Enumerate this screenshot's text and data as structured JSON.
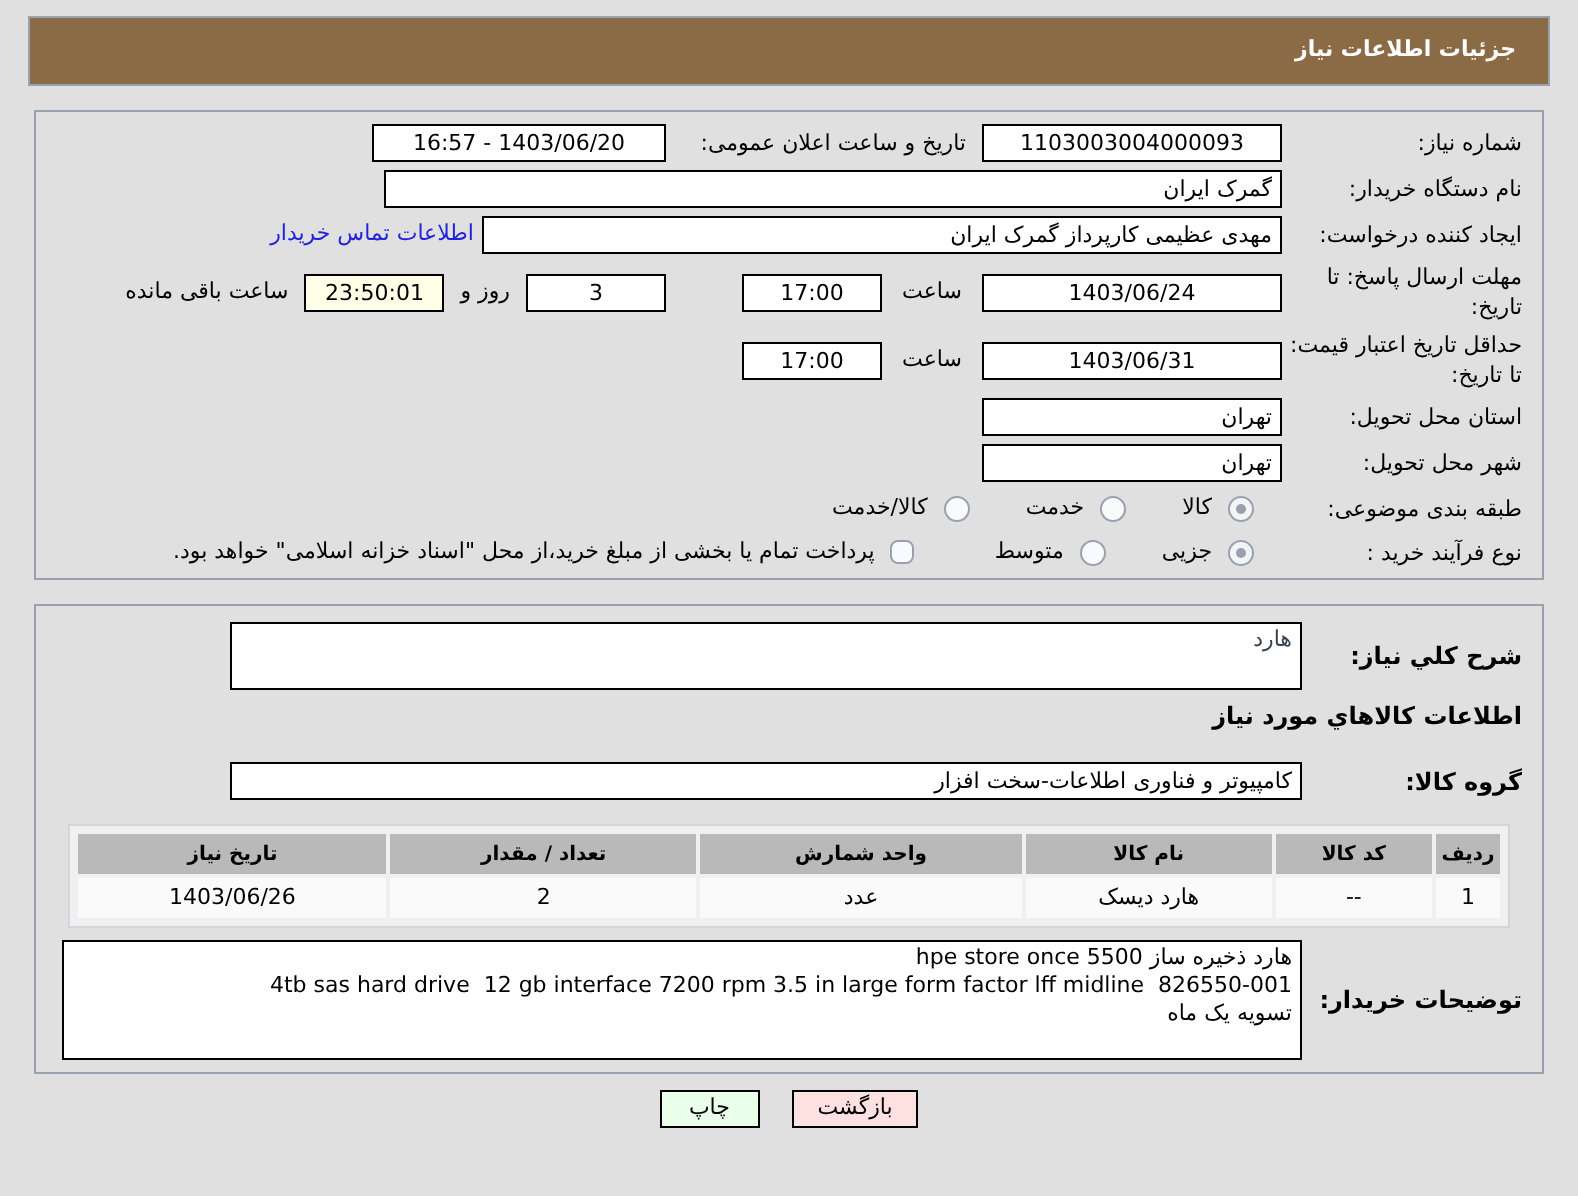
{
  "header": {
    "title": "جزئیات اطلاعات نیاز"
  },
  "need_number": {
    "label": "شماره نیاز:",
    "value": "1103003004000093"
  },
  "announce": {
    "label": "تاریخ و ساعت اعلان عمومی:",
    "value": "1403/06/20 - 16:57"
  },
  "buyer": {
    "label": "نام دستگاه خریدار:",
    "value": "گمرک ایران"
  },
  "requester": {
    "label": "ایجاد کننده درخواست:",
    "value": "مهدی عظیمی کارپرداز گمرک ایران",
    "link": "اطلاعات تماس خریدار"
  },
  "deadline": {
    "label": "مهلت ارسال پاسخ: تا تاریخ:",
    "date": "1403/06/24",
    "time_label": "ساعت",
    "time": "17:00",
    "days": "3",
    "days_label": "روز و",
    "remaining": "23:50:01",
    "remaining_label": "ساعت باقی مانده"
  },
  "validity": {
    "label": "حداقل تاریخ اعتبار قیمت: تا تاریخ:",
    "date": "1403/06/31",
    "time_label": "ساعت",
    "time": "17:00"
  },
  "province": {
    "label": "استان محل تحویل:",
    "value": "تهران"
  },
  "city": {
    "label": "شهر محل تحویل:",
    "value": "تهران"
  },
  "category": {
    "label": "طبقه بندی موضوعی:",
    "options": [
      {
        "label": "کالا",
        "selected": true
      },
      {
        "label": "خدمت",
        "selected": false
      },
      {
        "label": "کالا/خدمت",
        "selected": false
      }
    ]
  },
  "process": {
    "label": "نوع فرآیند خرید :",
    "options": [
      {
        "label": "جزیی",
        "selected": true
      },
      {
        "label": "متوسط",
        "selected": false
      }
    ],
    "treasury": {
      "label": "پرداخت تمام یا بخشی از مبلغ خرید،از محل \"اسناد خزانه اسلامی\" خواهد بود.",
      "checked": false
    }
  },
  "description": {
    "label": "شرح کلي نیاز:",
    "value": "هارد"
  },
  "goods_title": "اطلاعات کالاهاي مورد نیاز",
  "group": {
    "label": "گروه کالا:",
    "value": "کامپیوتر و فناوری اطلاعات-سخت افزار"
  },
  "table": {
    "columns": [
      "ردیف",
      "کد کالا",
      "نام کالا",
      "واحد شمارش",
      "تعداد / مقدار",
      "تاریخ نیاز"
    ],
    "rows": [
      [
        "1",
        "--",
        "هارد دیسک",
        "عدد",
        "2",
        "1403/06/26"
      ]
    ]
  },
  "notes": {
    "label": "توضیحات خریدار:",
    "lines": [
      "هارد ذخیره ساز hpe store once 5500",
      "4tb sas hard drive  12 gb interface 7200 rpm 3.5 in large form factor lff midline  826550-001",
      "تسویه یک ماه"
    ]
  },
  "buttons": [
    {
      "label": "بازگشت",
      "kind": "back"
    },
    {
      "label": "چاپ",
      "kind": "print"
    }
  ]
}
